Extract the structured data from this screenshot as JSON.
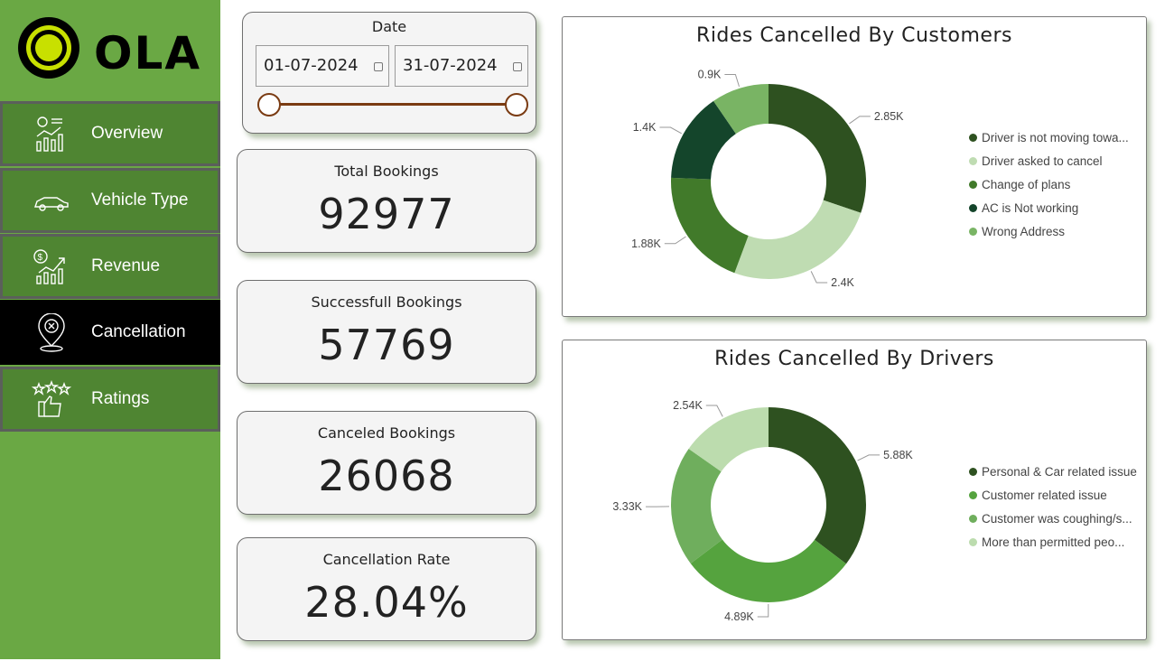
{
  "brand": {
    "name": "OLA"
  },
  "nav": [
    {
      "label": "Overview",
      "icon": "analytics-icon"
    },
    {
      "label": "Vehicle Type",
      "icon": "car-icon"
    },
    {
      "label": "Revenue",
      "icon": "revenue-growth-icon"
    },
    {
      "label": "Cancellation",
      "icon": "cancel-pin-icon",
      "active": true
    },
    {
      "label": "Ratings",
      "icon": "stars-thumbs-up-icon"
    }
  ],
  "date_filter": {
    "title": "Date",
    "start": "01-07-2024",
    "end": "31-07-2024"
  },
  "kpis": {
    "total": {
      "title": "Total Bookings",
      "value": "92977"
    },
    "success": {
      "title": "Successfull Bookings",
      "value": "57769"
    },
    "canceled": {
      "title": "Canceled Bookings",
      "value": "26068"
    },
    "rate": {
      "title": "Cancellation Rate",
      "value": "28.04%"
    }
  },
  "colors": {
    "sidebar": "#6aa844",
    "nav_item": "#4f8532",
    "nav_active": "#000000",
    "slider": "#7a3b12"
  },
  "chart_data": [
    {
      "type": "donut",
      "title": "Rides Cancelled By Customers",
      "categories": [
        "Driver is not moving towa...",
        "Driver asked to cancel",
        "Change of plans",
        "AC is Not working",
        "Wrong Address"
      ],
      "values": [
        2850,
        2400,
        1880,
        1400,
        900
      ],
      "labels": [
        "2.85K",
        "2.4K",
        "1.88K",
        "1.4K",
        "0.9K"
      ],
      "colors": [
        "#2e5120",
        "#bfdcb2",
        "#417a2a",
        "#14452b",
        "#79b464"
      ],
      "legend": "right"
    },
    {
      "type": "donut",
      "title": "Rides Cancelled By Drivers",
      "categories": [
        "Personal & Car related issue",
        "Customer related issue",
        "Customer was coughing/s...",
        "More than permitted peo..."
      ],
      "values": [
        5880,
        4890,
        3330,
        2540
      ],
      "labels": [
        "5.88K",
        "4.89K",
        "3.33K",
        "2.54K"
      ],
      "colors": [
        "#2e5120",
        "#55a33e",
        "#6fae5d",
        "#bcdcae"
      ],
      "legend": "right"
    }
  ]
}
